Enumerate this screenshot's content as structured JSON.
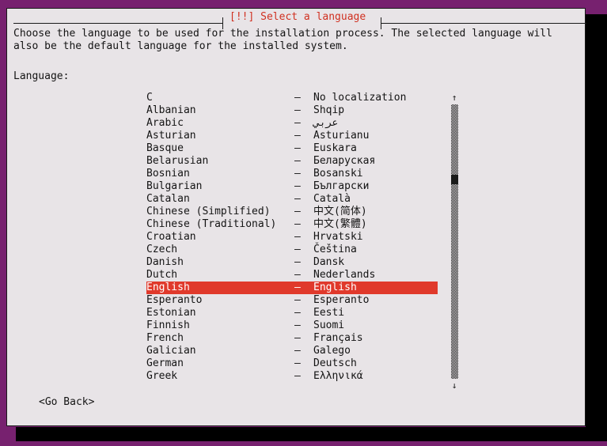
{
  "window": {
    "title": "[!!] Select a language",
    "title_color": "#d03020",
    "background_color": "#e8e4e7",
    "desktop_color": "#77216f",
    "highlight_color": "#e0392b"
  },
  "intro_text": "Choose the language to be used for the installation process. The selected language will also be the default language for the installed system.",
  "language_label": "Language:",
  "separator": "–",
  "languages": [
    {
      "name": "C",
      "native": "No localization",
      "selected": false
    },
    {
      "name": "Albanian",
      "native": "Shqip",
      "selected": false
    },
    {
      "name": "Arabic",
      "native": "عربي",
      "selected": false
    },
    {
      "name": "Asturian",
      "native": "Asturianu",
      "selected": false
    },
    {
      "name": "Basque",
      "native": "Euskara",
      "selected": false
    },
    {
      "name": "Belarusian",
      "native": "Беларуская",
      "selected": false
    },
    {
      "name": "Bosnian",
      "native": "Bosanski",
      "selected": false
    },
    {
      "name": "Bulgarian",
      "native": "Български",
      "selected": false
    },
    {
      "name": "Catalan",
      "native": "Català",
      "selected": false
    },
    {
      "name": "Chinese (Simplified)",
      "native": "中文(简体)",
      "selected": false
    },
    {
      "name": "Chinese (Traditional)",
      "native": "中文(繁體)",
      "selected": false
    },
    {
      "name": "Croatian",
      "native": "Hrvatski",
      "selected": false
    },
    {
      "name": "Czech",
      "native": "Čeština",
      "selected": false
    },
    {
      "name": "Danish",
      "native": "Dansk",
      "selected": false
    },
    {
      "name": "Dutch",
      "native": "Nederlands",
      "selected": false
    },
    {
      "name": "English",
      "native": "English",
      "selected": true
    },
    {
      "name": "Esperanto",
      "native": "Esperanto",
      "selected": false
    },
    {
      "name": "Estonian",
      "native": "Eesti",
      "selected": false
    },
    {
      "name": "Finnish",
      "native": "Suomi",
      "selected": false
    },
    {
      "name": "French",
      "native": "Français",
      "selected": false
    },
    {
      "name": "Galician",
      "native": "Galego",
      "selected": false
    },
    {
      "name": "German",
      "native": "Deutsch",
      "selected": false
    },
    {
      "name": "Greek",
      "native": "Ελληνικά",
      "selected": false
    }
  ],
  "scrollbar": {
    "up_arrow": "↑",
    "down_arrow": "↓"
  },
  "buttons": {
    "go_back": "<Go Back>"
  }
}
